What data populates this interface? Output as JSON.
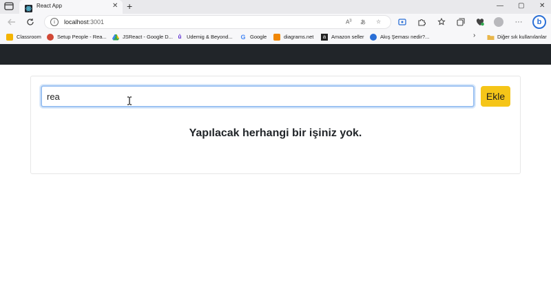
{
  "browser": {
    "tab_title": "React App",
    "new_tab": "+",
    "address_host": "localhost",
    "address_port": ":3001",
    "window_controls": {
      "minimize": "—",
      "maximize": "▢",
      "close": "✕"
    }
  },
  "bookmarks": [
    {
      "label": "Classroom",
      "icon": "classroom-icon",
      "color": "#f4b400"
    },
    {
      "label": "Setup People - Rea...",
      "icon": "people-icon",
      "color": "#d14836"
    },
    {
      "label": "JSReact - Google D...",
      "icon": "google-drive-icon",
      "color": "#34a853"
    },
    {
      "label": "Udemig & Beyond...",
      "icon": "udemy-icon",
      "color": "#5624d0"
    },
    {
      "label": "Google",
      "icon": "google-icon",
      "color": "#4285f4"
    },
    {
      "label": "diagrams.net",
      "icon": "diagrams-icon",
      "color": "#f08705"
    },
    {
      "label": "Amazon seller",
      "icon": "amazon-icon",
      "color": "#222222"
    },
    {
      "label": "Akış Şeması nedir?...",
      "icon": "edge-icon",
      "color": "#2a6fd6"
    },
    {
      "label": "Diğer sık kullanılanlar",
      "icon": "folder-icon",
      "color": "#e8b64a"
    }
  ],
  "app": {
    "input_value": "rea",
    "add_button_label": "Ekle",
    "empty_message": "Yapılacak herhangi bir işiniz yok."
  },
  "colors": {
    "navbar": "#212529",
    "accent_button": "#f5c518",
    "input_focus": "#9cc2f2"
  }
}
